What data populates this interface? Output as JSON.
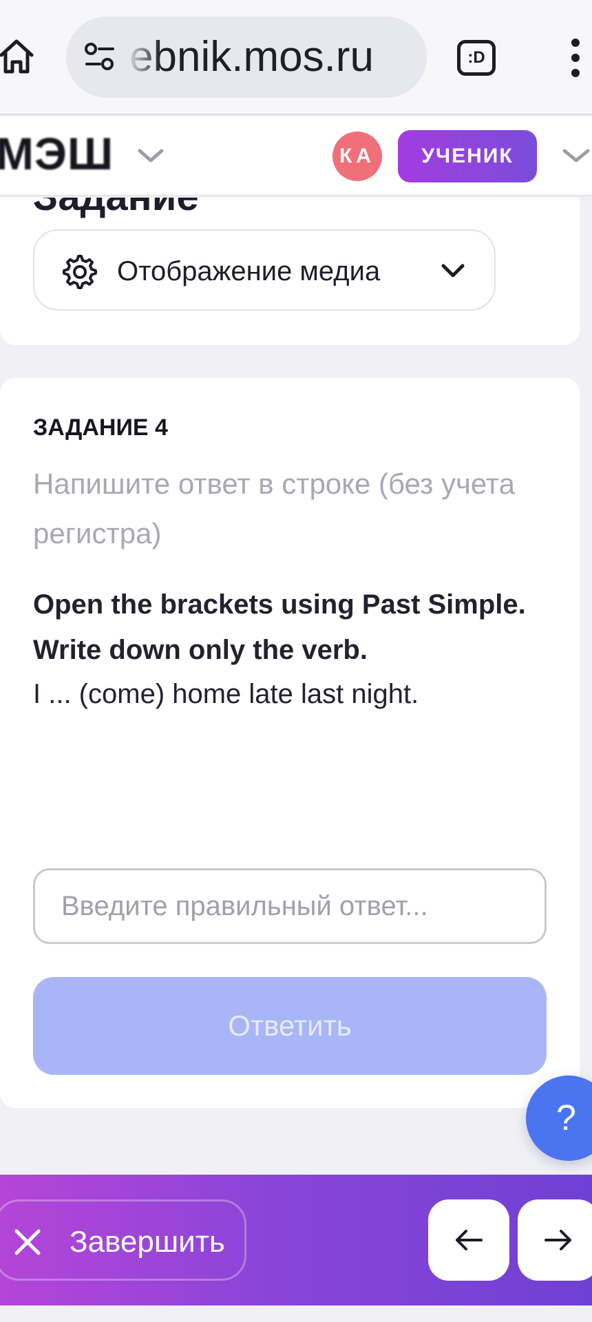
{
  "browser": {
    "url": "ebnik.mos.ru",
    "tab_label": ":D"
  },
  "header": {
    "logo": "МЭШ",
    "avatar_initials": "КА",
    "role_badge": "УЧЕНИК"
  },
  "top_card": {
    "title": "Задание",
    "media_dropdown_label": "Отображение медиа"
  },
  "task": {
    "number_label": "ЗАДАНИЕ 4",
    "hint": "Напишите ответ в строке (без учета регистра)",
    "instruction": "Open the brackets using Past Simple. Write down only the verb.",
    "sentence": "I ... (come) home late last night.",
    "answer_value": "",
    "answer_placeholder": "Введите правильный ответ...",
    "submit_label": "Ответить"
  },
  "help": {
    "label": "?"
  },
  "bottom_bar": {
    "finish_label": "Завершить"
  },
  "icons": {
    "home": "home-icon",
    "site_settings": "tune-icon",
    "tabs": "tab-switcher-icon",
    "menu": "kebab-menu-icon",
    "settings": "gear-icon",
    "dropdown": "chevron-down-icon",
    "close": "close-icon",
    "prev": "arrow-left-icon",
    "next": "arrow-right-icon"
  },
  "colors": {
    "accent_gradient_start": "#b445d8",
    "accent_gradient_end": "#7040d4",
    "submit_disabled": "#a8b6f7",
    "help_button": "#4a74f0",
    "avatar": "#f0707a",
    "role_badge": "#8f45de"
  }
}
